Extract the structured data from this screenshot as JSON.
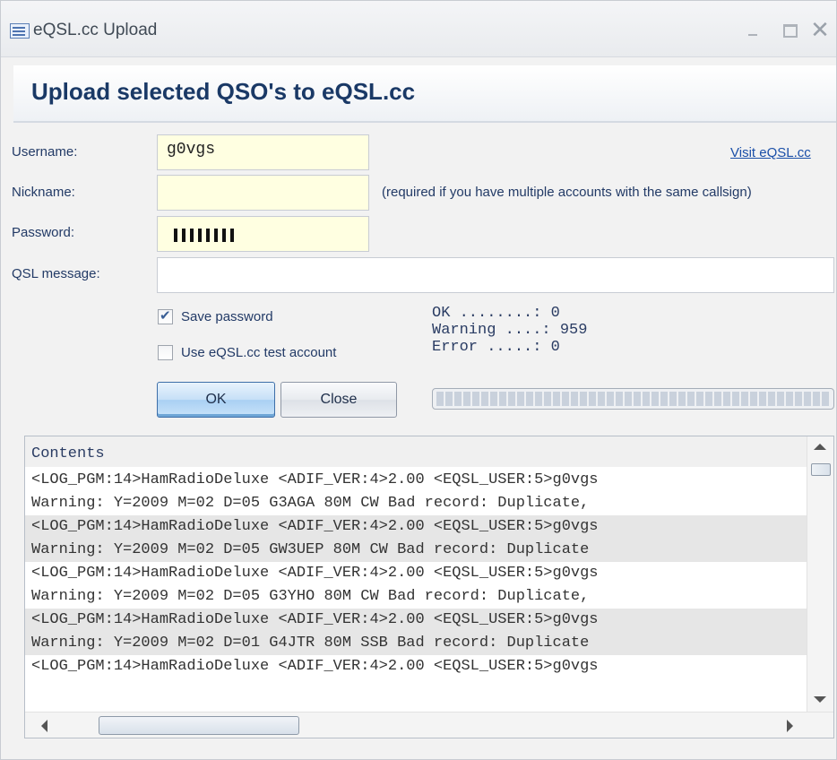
{
  "window": {
    "title": "eQSL.cc Upload"
  },
  "header": {
    "title": "Upload selected QSO's to eQSL.cc"
  },
  "form": {
    "username_label": "Username:",
    "username_value": "g0vgs",
    "nickname_label": "Nickname:",
    "nickname_value": "",
    "nickname_hint": "(required if you have multiple accounts with the same callsign)",
    "password_label": "Password:",
    "password_masked_length": 8,
    "qsl_message_label": "QSL message:",
    "qsl_message_value": "",
    "visit_link": "Visit eQSL.cc"
  },
  "options": {
    "save_password_label": "Save password",
    "save_password_checked": true,
    "test_account_label": "Use eQSL.cc test account",
    "test_account_checked": false
  },
  "stats": {
    "ok": "OK ........: 0",
    "warning": "Warning ....: 959",
    "error": "Error .....: 0"
  },
  "buttons": {
    "ok": "OK",
    "close": "Close"
  },
  "progress": {
    "fraction": 1.0
  },
  "contents": {
    "header": "Contents",
    "lines": [
      "<LOG_PGM:14>HamRadioDeluxe <ADIF_VER:4>2.00 <EQSL_USER:5>g0vgs",
      "Warning: Y=2009 M=02 D=05 G3AGA 80M CW Bad record: Duplicate,",
      "<LOG_PGM:14>HamRadioDeluxe <ADIF_VER:4>2.00 <EQSL_USER:5>g0vgs",
      "Warning: Y=2009 M=02 D=05 GW3UEP 80M CW Bad record: Duplicate",
      "<LOG_PGM:14>HamRadioDeluxe <ADIF_VER:4>2.00 <EQSL_USER:5>g0vgs",
      "Warning: Y=2009 M=02 D=05 G3YHO 80M CW Bad record: Duplicate,",
      "<LOG_PGM:14>HamRadioDeluxe <ADIF_VER:4>2.00 <EQSL_USER:5>g0vgs",
      "Warning: Y=2009 M=02 D=01 G4JTR 80M SSB Bad record: Duplicate",
      "<LOG_PGM:14>HamRadioDeluxe <ADIF_VER:4>2.00 <EQSL_USER:5>g0vgs"
    ]
  }
}
